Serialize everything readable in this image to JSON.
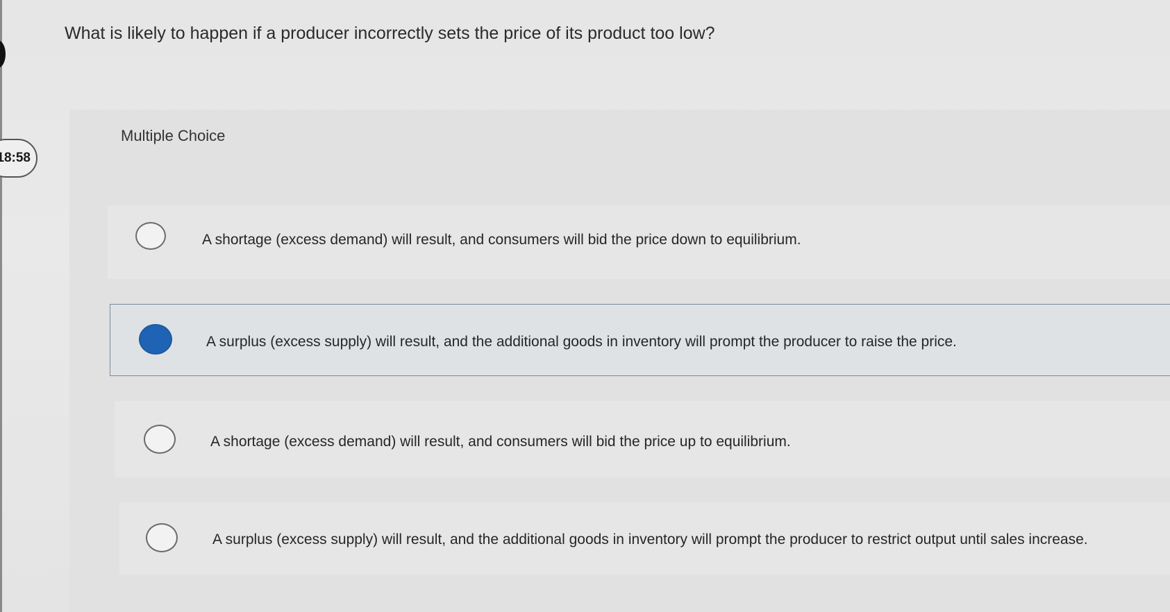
{
  "timer": {
    "display": "18:58"
  },
  "question": {
    "text": "What is likely to happen if a producer incorrectly sets the price of its product too low?"
  },
  "question_type": {
    "label": "Multiple Choice"
  },
  "options": [
    {
      "text": "A shortage (excess demand) will result, and consumers will bid the price down to equilibrium.",
      "selected": false
    },
    {
      "text": "A surplus (excess supply) will result, and the additional goods in inventory will prompt the producer to raise the price.",
      "selected": true
    },
    {
      "text": "A shortage (excess demand) will result, and consumers will bid the price up to equilibrium.",
      "selected": false
    },
    {
      "text": "A surplus (excess supply) will result, and the additional goods in inventory will prompt the producer to restrict output until sales increase.",
      "selected": false
    }
  ],
  "colors": {
    "selected_radio": "#1f63b5",
    "background": "#e6e6e6"
  }
}
